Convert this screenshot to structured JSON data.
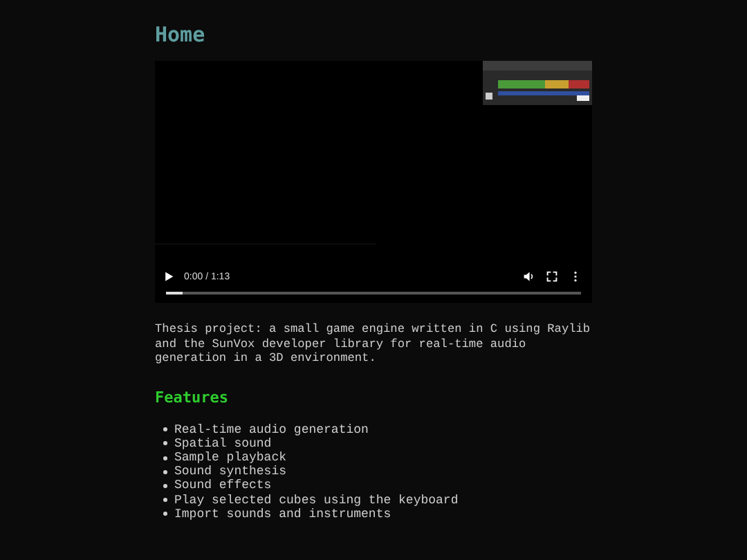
{
  "title": "Home",
  "video": {
    "time": "0:00 / 1:13",
    "level": 0.04
  },
  "description": "Thesis project: a small game engine written in C using Raylib and the SunVox developer library for real-time audio generation in a 3D environment.",
  "features_heading": "Features",
  "features": [
    "Real-time audio generation",
    "Spatial sound",
    "Sample playback",
    "Sound synthesis",
    "Sound effects",
    "Play selected cubes using the keyboard",
    "Import sounds and instruments"
  ]
}
